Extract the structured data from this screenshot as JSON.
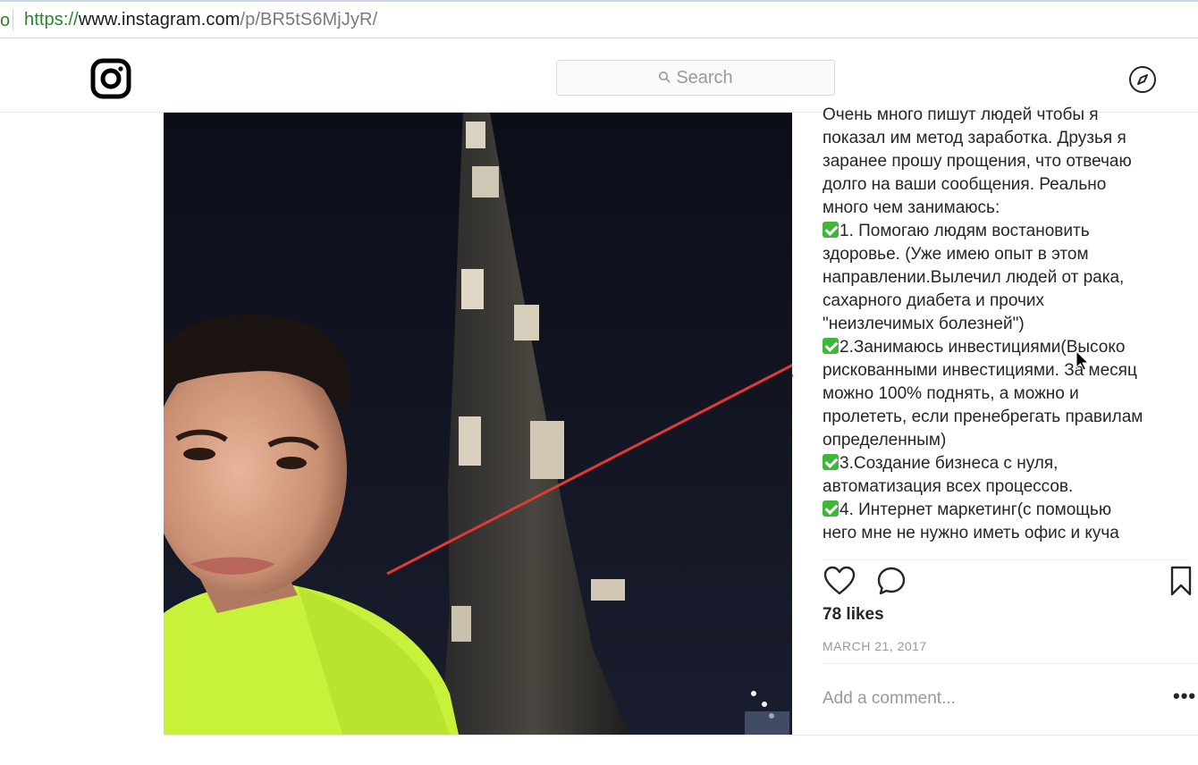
{
  "browser": {
    "left_fragment": "o",
    "url_scheme": "https://",
    "url_host": "www.instagram.com",
    "url_path": "/p/BR5tS6MjJyR/"
  },
  "header": {
    "logo_icon": "instagram-logo-icon",
    "search_placeholder": "Search",
    "explore_icon": "compass-icon"
  },
  "post": {
    "caption_lines": [
      "Очень много пишут людей чтобы я",
      "показал им метод заработка. Друзья я",
      "заранее прошу прощения, что отвечаю",
      "долго на ваши сообщения. Реально",
      "много чем занимаюсь:",
      "1. Помогаю людям востановить",
      "здоровье. (Уже имею опыт в этом",
      "направлении.Вылечил людей от рака,",
      "сахарного диабета и прочих",
      "\"неизлечимых болезней\")",
      "2.Занимаюсь инвестициями(Высоко",
      "рискованными инвестициями. За месяц",
      "можно 100% поднять, а можно и",
      "пролететь, если пренебрегать правилам",
      "определенным)",
      "3.Создание бизнеса с нуля,",
      "автоматизация всех процессов.",
      "4. Интернет маркетинг(с помощью",
      "него мне не нужно иметь офис и куча"
    ],
    "likes": "78 likes",
    "date": "MARCH 21, 2017",
    "comment_placeholder": "Add a comment...",
    "more_label": "•••"
  },
  "colors": {
    "accent_arrow": "#e53935",
    "check_green": "#3fb83a"
  }
}
